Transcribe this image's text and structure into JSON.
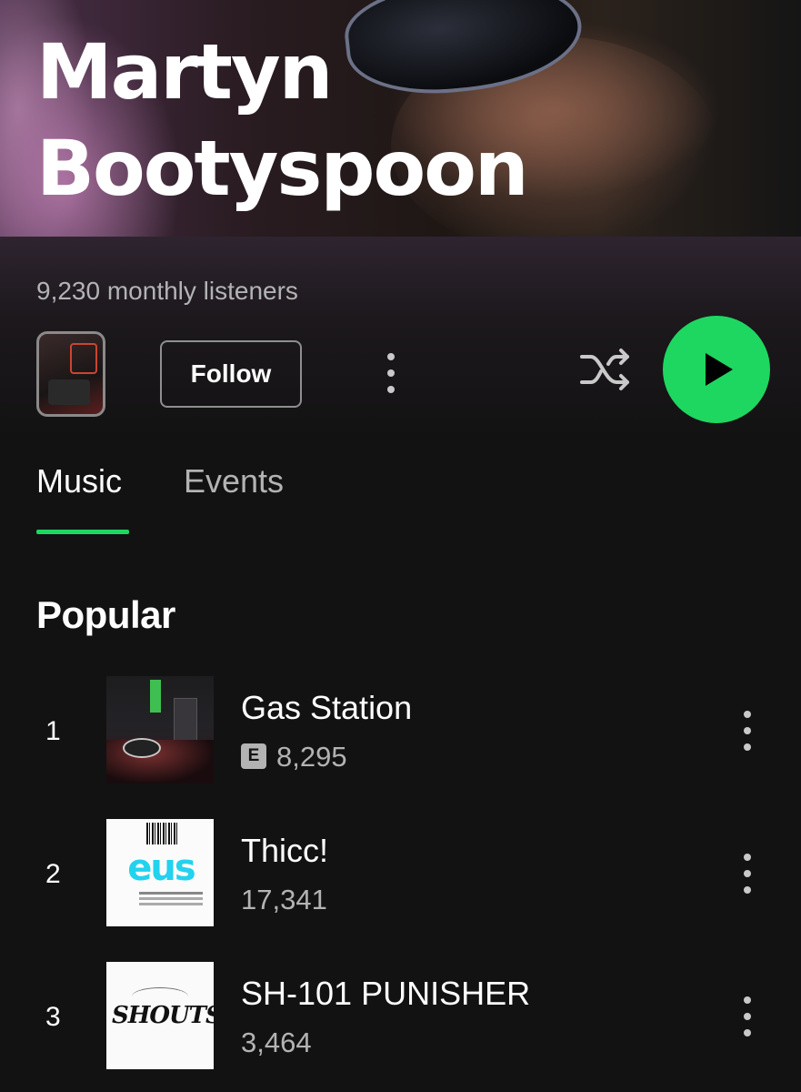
{
  "artist": {
    "name": "Martyn Bootyspoon",
    "name_lines": [
      "Martyn",
      "Bootyspoon"
    ],
    "monthly_listeners": "9,230 monthly listeners"
  },
  "actions": {
    "follow_label": "Follow",
    "more_icon": "more-vertical-icon",
    "shuffle_icon": "shuffle-icon",
    "play_icon": "play-icon"
  },
  "tabs": [
    {
      "label": "Music",
      "active": true
    },
    {
      "label": "Events",
      "active": false
    }
  ],
  "popular": {
    "title": "Popular",
    "tracks": [
      {
        "rank": "1",
        "title": "Gas Station",
        "explicit": true,
        "explicit_label": "E",
        "plays": "8,295"
      },
      {
        "rank": "2",
        "title": "Thicc!",
        "explicit": false,
        "plays": "17,341"
      },
      {
        "rank": "3",
        "title": "SH-101 PUNISHER",
        "explicit": false,
        "plays": "3,464"
      }
    ]
  },
  "colors": {
    "accent": "#1ed760",
    "background": "#121212",
    "text_secondary": "#b3b3b3"
  }
}
